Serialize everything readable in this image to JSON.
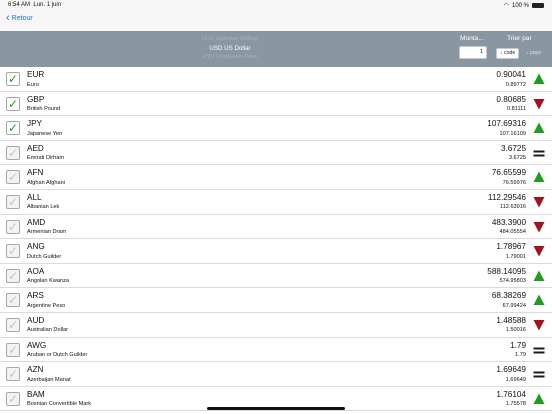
{
  "status_bar": {
    "time": "6:54 AM",
    "date": "Lun. 1 juin",
    "battery": "100 %"
  },
  "nav": {
    "back_label": "Retour"
  },
  "header": {
    "picker_items": [
      {
        "label": "UGX Ugandan Shilling",
        "selected": false
      },
      {
        "label": "USD US Dollar",
        "selected": true
      },
      {
        "label": "UYU Uruguayan Peso",
        "selected": false
      }
    ],
    "amount_label": "Monta...",
    "amount_value": "1",
    "sort_label": "Trier par",
    "sort_options": [
      {
        "label": "↓ code",
        "active": true
      },
      {
        "label": "↓ pays",
        "active": false
      }
    ]
  },
  "colors": {
    "up": "#1f9d1f",
    "down": "#a1141b",
    "flat": "#1c1c1c",
    "accent": "#1a73e8"
  },
  "rows": [
    {
      "code": "EUR",
      "name": "Euro",
      "value": "0.90041",
      "previous": "0.89772",
      "trend": "up",
      "checked": true
    },
    {
      "code": "GBP",
      "name": "British Pound",
      "value": "0.80685",
      "previous": "0.81111",
      "trend": "down",
      "checked": true
    },
    {
      "code": "JPY",
      "name": "Japanese Yen",
      "value": "107.69316",
      "previous": "107.16109",
      "trend": "up",
      "checked": true
    },
    {
      "code": "AED",
      "name": "Emirati Dirham",
      "value": "3.6725",
      "previous": "3.6725",
      "trend": "flat",
      "checked": false
    },
    {
      "code": "AFN",
      "name": "Afghan Afghani",
      "value": "76.65599",
      "previous": "76.59976",
      "trend": "up",
      "checked": false
    },
    {
      "code": "ALL",
      "name": "Albanian Lek",
      "value": "112.29546",
      "previous": "112.63916",
      "trend": "down",
      "checked": false
    },
    {
      "code": "AMD",
      "name": "Armenian Dram",
      "value": "483.3900",
      "previous": "484.05554",
      "trend": "down",
      "checked": false
    },
    {
      "code": "ANG",
      "name": "Dutch Guilder",
      "value": "1.78967",
      "previous": "1.79001",
      "trend": "down",
      "checked": false
    },
    {
      "code": "AOA",
      "name": "Angolan Kwanza",
      "value": "588.14095",
      "previous": "574.95803",
      "trend": "up",
      "checked": false
    },
    {
      "code": "ARS",
      "name": "Argentine Peso",
      "value": "68.38269",
      "previous": "67.99424",
      "trend": "up",
      "checked": false
    },
    {
      "code": "AUD",
      "name": "Australian Dollar",
      "value": "1.48588",
      "previous": "1.50016",
      "trend": "down",
      "checked": false
    },
    {
      "code": "AWG",
      "name": "Aruban or Dutch Guilder",
      "value": "1.79",
      "previous": "1.79",
      "trend": "flat",
      "checked": false
    },
    {
      "code": "AZN",
      "name": "Azerbaijan Manat",
      "value": "1.69649",
      "previous": "1.69649",
      "trend": "flat",
      "checked": false
    },
    {
      "code": "BAM",
      "name": "Bosnian Convertible Mark",
      "value": "1.76104",
      "previous": "1.75578",
      "trend": "up",
      "checked": false
    }
  ]
}
